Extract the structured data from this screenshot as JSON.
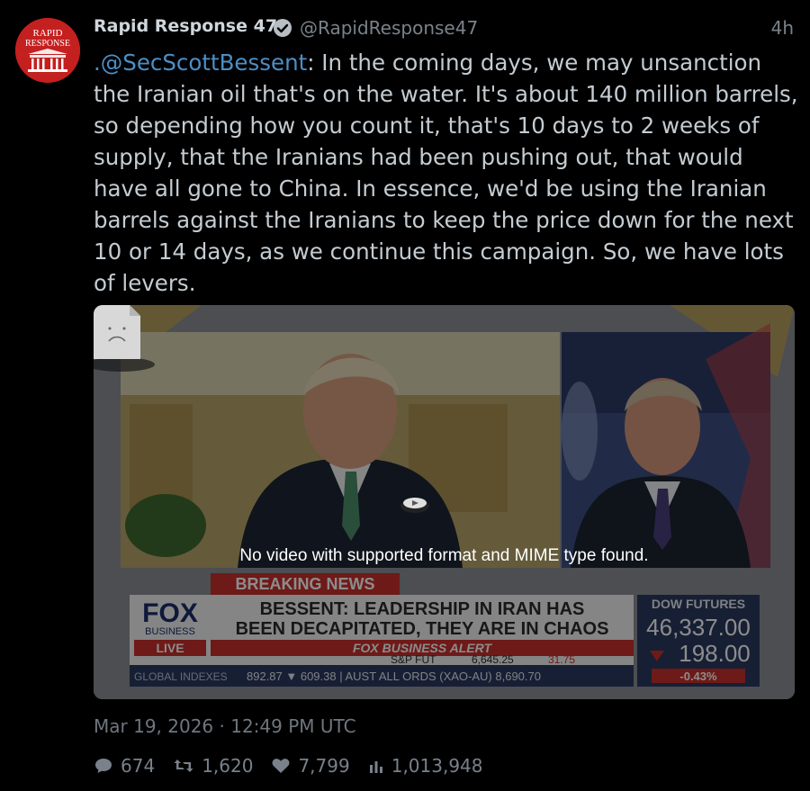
{
  "account": {
    "avatar_line1": "RAPID",
    "avatar_line2": "RESPONSE",
    "display_name": "Rapid Response 47",
    "handle": "@RapidResponse47",
    "time_ago": "4h"
  },
  "tweet": {
    "mention": ".@SecScottBessent",
    "body": ": In the coming days, we may unsanction the Iranian oil that's on the water. It's about 140 million barrels, so depending how you count it, that's 10 days to 2 weeks of supply, that the Iranians had been pushing out, that would have all gone to China. In essence, we'd be using the Iranian barrels against the Iranians to keep the price down for the next 10 or 14 days, as we continue this campaign. So, we have lots of levers."
  },
  "media": {
    "error_message": "No video with supported format and MIME type found.",
    "broadcast": {
      "breaking": "BREAKING NEWS",
      "network_line1": "FOX",
      "network_line2": "BUSINESS",
      "live": "LIVE",
      "headline_line1": "BESSENT: LEADERSHIP IN IRAN HAS",
      "headline_line2": "BEEN DECAPITATED, THEY ARE IN CHAOS",
      "alert": "FOX BUSINESS ALERT",
      "sp_label": "S&P FUT",
      "sp_value": "6,645.25",
      "sp_change": "31.75",
      "global_label": "GLOBAL INDEXES",
      "global_values": "892.87  ▼ 609.38  |  AUST ALL ORDS (XAO-AU) 8,690.70",
      "dow_label": "DOW FUTURES",
      "dow_value": "46,337.00",
      "dow_change": "198.00",
      "dow_pct": "-0.43%"
    }
  },
  "timestamp": "Mar 19, 2026 · 12:49 PM UTC",
  "stats": {
    "replies": "674",
    "reposts": "1,620",
    "likes": "7,799",
    "views": "1,013,948"
  },
  "colors": {
    "background": "#000000",
    "mention": "#4a8fc7",
    "text": "#c4ccd2",
    "muted": "#7a828a",
    "avatar_red": "#c4201f"
  }
}
